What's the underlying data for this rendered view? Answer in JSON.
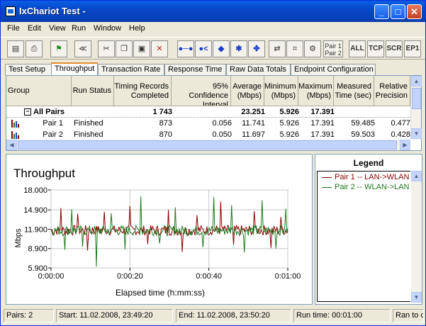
{
  "window": {
    "title": "IxChariot Test -"
  },
  "window_controls": {
    "minimize": "_",
    "maximize": "□",
    "close": "✕"
  },
  "menu": [
    "File",
    "Edit",
    "View",
    "Run",
    "Window",
    "Help"
  ],
  "toolbar": {
    "all": "ALL",
    "tcp": "TCP",
    "scr": "SCR",
    "ep1": "EP1",
    "pair_line1": "Pair 1",
    "pair_line2": "Pair 2"
  },
  "tabs": [
    "Test Setup",
    "Throughput",
    "Transaction Rate",
    "Response Time",
    "Raw Data Totals",
    "Endpoint Configuration"
  ],
  "active_tab": "Throughput",
  "table": {
    "headers": {
      "group": "Group",
      "run_status": "Run Status",
      "timing_records": [
        "Timing Records",
        "Completed"
      ],
      "confidence": [
        "95% Confidence",
        "Interval"
      ],
      "average": [
        "Average",
        "(Mbps)"
      ],
      "minimum": [
        "Minimum",
        "(Mbps)"
      ],
      "maximum": [
        "Maximum",
        "(Mbps)"
      ],
      "measured_time": [
        "Measured",
        "Time (sec)"
      ],
      "relative_precision": [
        "Relative",
        "Precision"
      ]
    },
    "all_pairs": {
      "label": "All Pairs",
      "expander": "−",
      "records": "1 743",
      "average": "23.251",
      "minimum": "5.926",
      "maximum": "17.391"
    },
    "rows": [
      {
        "name": "Pair 1",
        "status": "Finished",
        "records": "873",
        "confidence": "0.056",
        "average": "11.741",
        "minimum": "5.926",
        "maximum": "17.391",
        "time": "59.485",
        "precision": "0.477"
      },
      {
        "name": "Pair 2",
        "status": "Finished",
        "records": "870",
        "confidence": "0.050",
        "average": "11.697",
        "minimum": "5.926",
        "maximum": "17.391",
        "time": "59.503",
        "precision": "0.428"
      }
    ]
  },
  "legend": {
    "title": "Legend",
    "entries": [
      {
        "label": "Pair 1 -- LAN->WLAN",
        "color": "#8b0000"
      },
      {
        "label": "Pair 2 -- WLAN->LAN",
        "color": "#1e7a1e"
      }
    ]
  },
  "status": {
    "pairs": "Pairs: 2",
    "start": "Start: 11.02.2008, 23:49:20",
    "end": "End: 11.02.2008, 23:50:20",
    "runtime": "Run time: 00:01:00",
    "ran": "Ran to c"
  },
  "chart_data": {
    "type": "line",
    "title": "Throughput",
    "xlabel": "Elapsed time (h:mm:ss)",
    "ylabel": "Mbps",
    "ylim": [
      5.9,
      18.0
    ],
    "xlim": [
      0,
      60
    ],
    "yticks": [
      "18.000",
      "14.900",
      "11.900",
      "8.900",
      "5.900"
    ],
    "xticks": [
      "0:00:00",
      "0:00:20",
      "0:00:40",
      "0:01:00"
    ],
    "grid": true,
    "series": [
      {
        "name": "Pair 1 -- LAN->WLAN",
        "color": "#8b0000",
        "baseline": 11.74,
        "spikes": [
          [
            2.5,
            15.2
          ],
          [
            6.8,
            14.3
          ],
          [
            9.2,
            8.6
          ],
          [
            13.5,
            14.6
          ],
          [
            20.1,
            15.5
          ],
          [
            24.6,
            9.6
          ],
          [
            29.8,
            14.9
          ],
          [
            33.3,
            8.4
          ],
          [
            36.9,
            14.1
          ],
          [
            43.0,
            16.2
          ],
          [
            46.2,
            9.5
          ],
          [
            51.4,
            14.7
          ],
          [
            55.8,
            9.0
          ],
          [
            58.3,
            13.8
          ]
        ]
      },
      {
        "name": "Pair 2 -- WLAN->LAN",
        "color": "#1e7a1e",
        "baseline": 11.7,
        "spikes": [
          [
            3.6,
            8.7
          ],
          [
            5.3,
            15.0
          ],
          [
            8.1,
            9.2
          ],
          [
            11.4,
            6.1
          ],
          [
            15.2,
            14.4
          ],
          [
            18.8,
            8.8
          ],
          [
            22.7,
            17.0
          ],
          [
            27.4,
            9.7
          ],
          [
            31.6,
            15.3
          ],
          [
            38.5,
            9.1
          ],
          [
            41.3,
            16.9
          ],
          [
            45.7,
            15.6
          ],
          [
            49.1,
            8.3
          ],
          [
            53.5,
            16.4
          ],
          [
            57.1,
            8.9
          ],
          [
            59.6,
            15.1
          ]
        ]
      }
    ]
  }
}
